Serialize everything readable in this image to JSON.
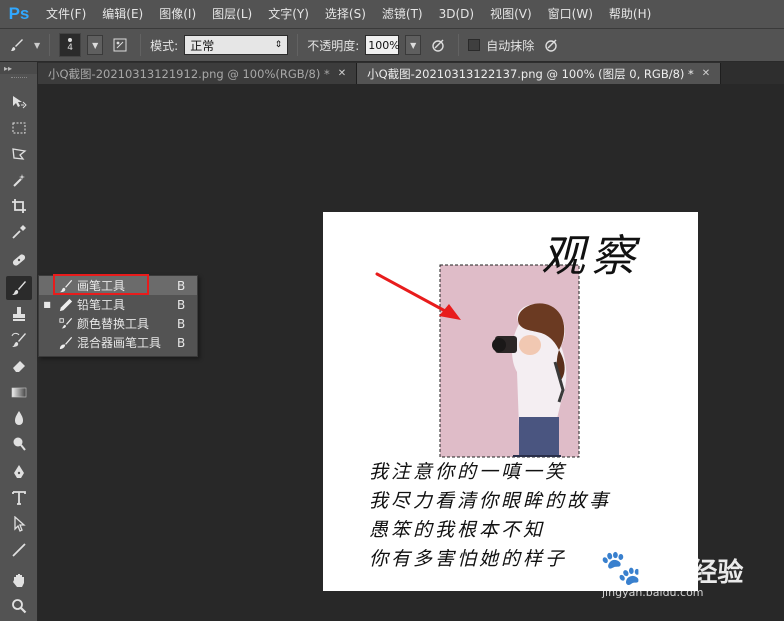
{
  "app": {
    "logo": "Ps"
  },
  "menu": [
    "文件(F)",
    "编辑(E)",
    "图像(I)",
    "图层(L)",
    "文字(Y)",
    "选择(S)",
    "滤镜(T)",
    "3D(D)",
    "视图(V)",
    "窗口(W)",
    "帮助(H)"
  ],
  "options": {
    "brush_size": "4",
    "mode_label": "模式:",
    "mode_value": "正常",
    "opacity_label": "不透明度:",
    "opacity_value": "100%",
    "auto_erase_label": "自动抹除"
  },
  "tabs": [
    {
      "label": "小Q截图-20210313121912.png @ 100%(RGB/8) *",
      "active": false
    },
    {
      "label": "小Q截图-20210313122137.png @ 100% (图层 0, RGB/8) *",
      "active": true
    }
  ],
  "flyout": [
    {
      "label": "画笔工具",
      "key": "B",
      "selected": true,
      "icon": "brush-icon"
    },
    {
      "label": "铅笔工具",
      "key": "B",
      "selected": false,
      "icon": "pencil-icon"
    },
    {
      "label": "颜色替换工具",
      "key": "B",
      "selected": false,
      "icon": "color-replacement-icon"
    },
    {
      "label": "混合器画笔工具",
      "key": "B",
      "selected": false,
      "icon": "mixer-brush-icon"
    }
  ],
  "document": {
    "title_text": "观察",
    "poem": [
      "我注意你的一嗔一笑",
      "我尽力看清你眼眸的故事",
      "愚笨的我根本不知",
      "你有多害怕她的样子"
    ]
  },
  "watermark": {
    "brand": "Bai 经验",
    "url": "jingyan.baidu.com"
  },
  "colors": {
    "accent": "#31a8ff",
    "annotation_red": "#e81c1c",
    "selection_fill": "#dfbcc8"
  }
}
